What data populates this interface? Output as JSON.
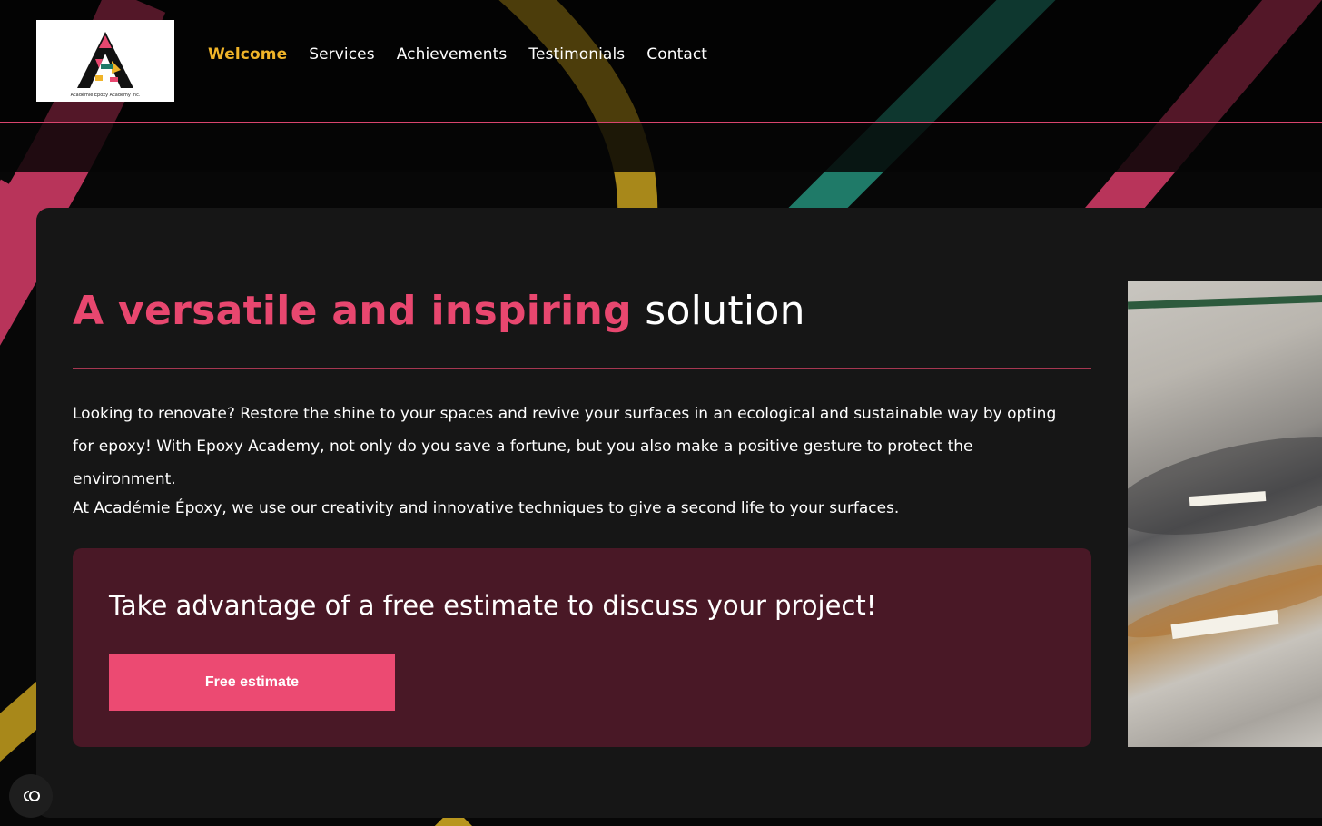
{
  "logo": {
    "alt": "Académie Epoxy Academy Inc. logo",
    "letter": "A",
    "caption": "Académie Epoxy Academy Inc."
  },
  "nav": {
    "items": [
      {
        "label": "Welcome",
        "active": true
      },
      {
        "label": "Services",
        "active": false
      },
      {
        "label": "Achievements",
        "active": false
      },
      {
        "label": "Testimonials",
        "active": false
      },
      {
        "label": "Contact",
        "active": false
      }
    ]
  },
  "hero": {
    "title_accent": "A versatile and inspiring",
    "title_plain": " solution",
    "paragraph1": "Looking to renovate? Restore the shine to your spaces and revive your surfaces in an ecological and sustainable way by opting for epoxy! With Epoxy Academy, not only do you save a fortune, but you also make a positive gesture to protect the environment.",
    "paragraph2": "At Académie Époxy, we use our creativity and innovative techniques to give a second life to your surfaces."
  },
  "cta": {
    "text": "Take advantage of a free estimate to discuss your project!",
    "button_label": "Free estimate"
  },
  "image": {
    "icon": "epoxy-floor-photo"
  },
  "accessibility": {
    "icon": "accessibility-icon"
  },
  "colors": {
    "accent_pink": "#e8476f",
    "nav_active": "#f0b429",
    "card_bg": "#161616",
    "cta_bg": "#491826",
    "stripe_pink": "#b8345a",
    "stripe_gold": "#b8961e",
    "stripe_teal": "#1f7a68"
  }
}
